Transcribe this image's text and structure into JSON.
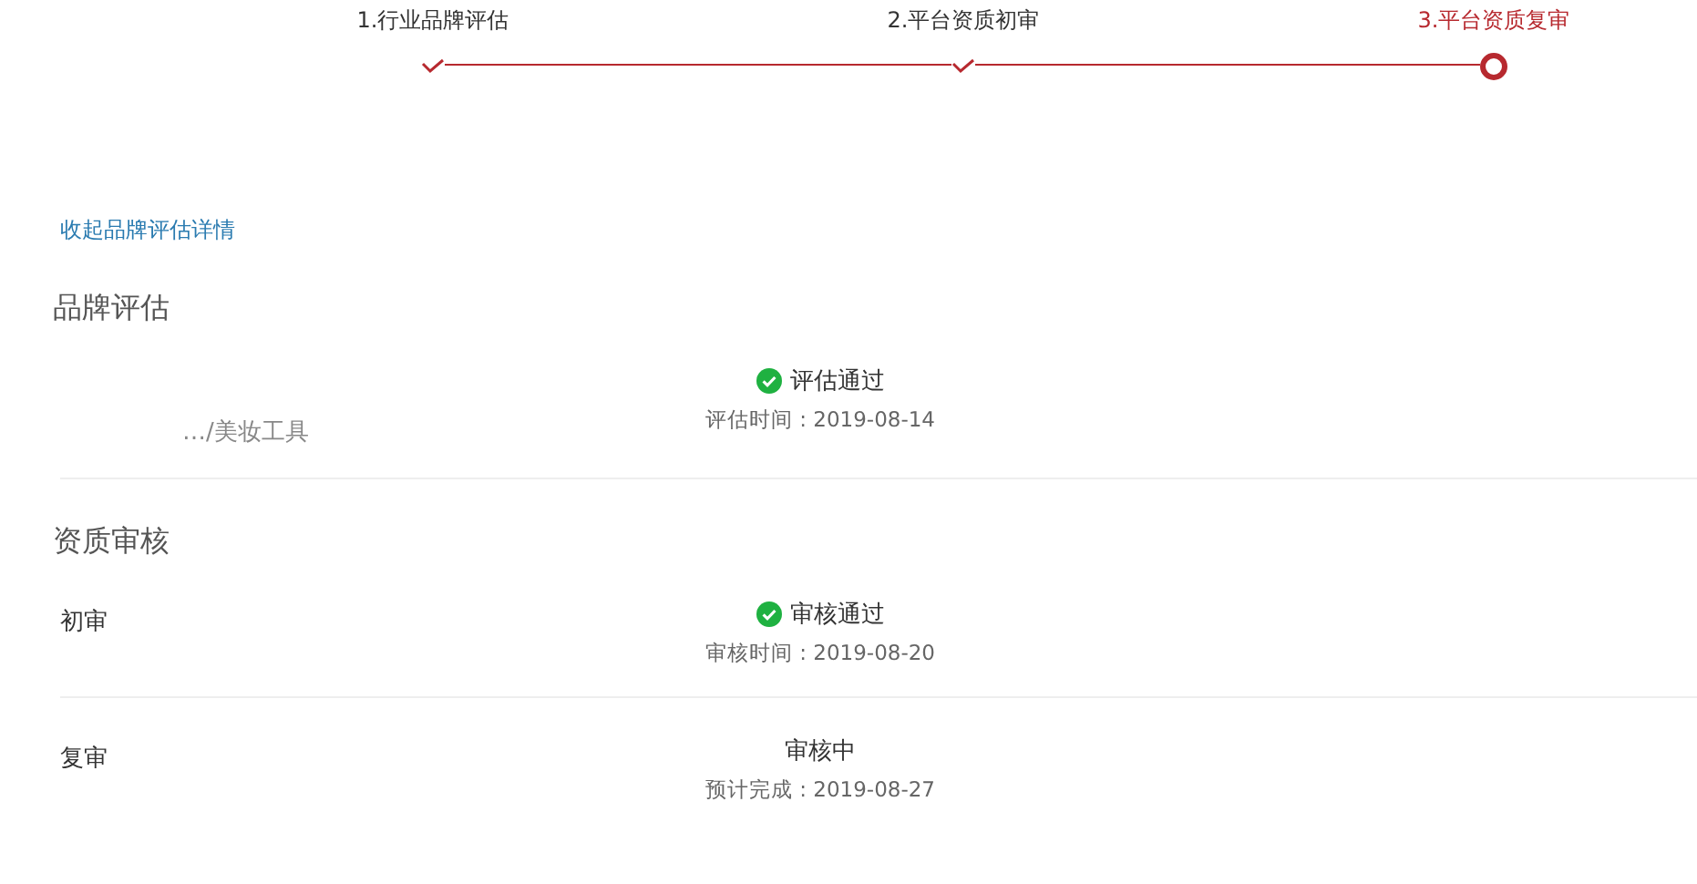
{
  "steps": [
    {
      "label": "1.行业品牌评估",
      "kind": "done"
    },
    {
      "label": "2.平台资质初审",
      "kind": "done"
    },
    {
      "label": "3.平台资质复审",
      "kind": "current"
    }
  ],
  "collapse_link": "收起品牌评估详情",
  "sections": [
    {
      "title": "品牌评估",
      "rows": [
        {
          "label": "…/美妆工具",
          "kind": "muted",
          "status": "评估通过",
          "passed": true,
          "time": "评估时间 : 2019-08-14"
        }
      ]
    },
    {
      "title": "资质审核",
      "rows": [
        {
          "label": "初审",
          "kind": "plain",
          "status": "审核通过",
          "passed": true,
          "time": "审核时间 : 2019-08-20"
        },
        {
          "label": "复审",
          "kind": "plain",
          "status": "审核中",
          "passed": false,
          "time": "预计完成 : 2019-08-27"
        }
      ]
    }
  ]
}
